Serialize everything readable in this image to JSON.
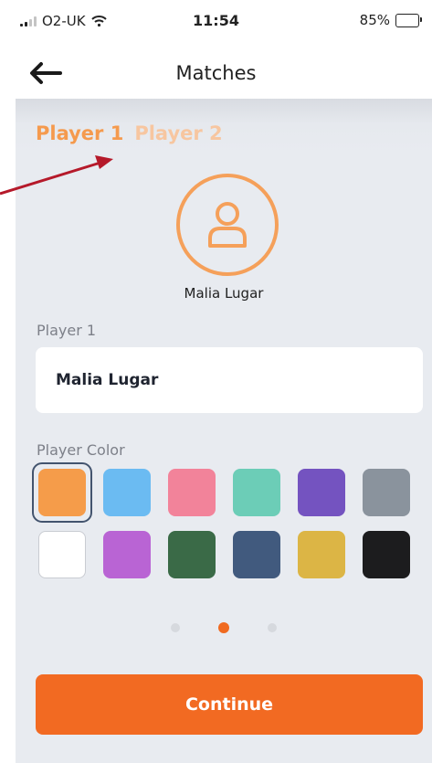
{
  "status_bar": {
    "carrier": "O2-UK",
    "time": "11:54",
    "battery_percent": "85%",
    "battery_level": 0.85
  },
  "header": {
    "title": "Matches",
    "back_icon": "arrow-left-icon"
  },
  "tabs": [
    {
      "label": "Player 1",
      "active": true
    },
    {
      "label": "Player 2",
      "active": false
    }
  ],
  "player": {
    "avatar_icon": "user-icon",
    "display_name": "Malia Lugar",
    "name_label": "Player 1",
    "name_value": "Malia Lugar"
  },
  "color_picker": {
    "label": "Player Color",
    "selected_index": 0,
    "colors": [
      "#f59c4a",
      "#6bbbf2",
      "#f2839a",
      "#6ccdb7",
      "#7453c0",
      "#8a939d",
      "#ffffff",
      "#b964d4",
      "#3a6a47",
      "#415a7e",
      "#dcb545",
      "#1c1c1e"
    ]
  },
  "pager": {
    "pages": 3,
    "active_index": 1
  },
  "continue_button": {
    "label": "Continue"
  },
  "accent_colors": {
    "primary": "#f26a22",
    "tab_active": "#f59a4d",
    "arrow": "#b5192a"
  }
}
